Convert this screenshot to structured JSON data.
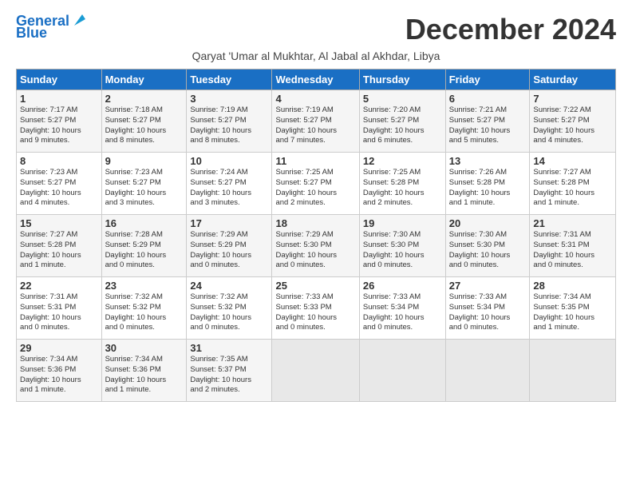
{
  "logo": {
    "line1": "General",
    "line2": "Blue"
  },
  "title": "December 2024",
  "subtitle": "Qaryat 'Umar al Mukhtar, Al Jabal al Akhdar, Libya",
  "headers": [
    "Sunday",
    "Monday",
    "Tuesday",
    "Wednesday",
    "Thursday",
    "Friday",
    "Saturday"
  ],
  "weeks": [
    [
      {
        "day": "1",
        "info": "Sunrise: 7:17 AM\nSunset: 5:27 PM\nDaylight: 10 hours\nand 9 minutes."
      },
      {
        "day": "2",
        "info": "Sunrise: 7:18 AM\nSunset: 5:27 PM\nDaylight: 10 hours\nand 8 minutes."
      },
      {
        "day": "3",
        "info": "Sunrise: 7:19 AM\nSunset: 5:27 PM\nDaylight: 10 hours\nand 8 minutes."
      },
      {
        "day": "4",
        "info": "Sunrise: 7:19 AM\nSunset: 5:27 PM\nDaylight: 10 hours\nand 7 minutes."
      },
      {
        "day": "5",
        "info": "Sunrise: 7:20 AM\nSunset: 5:27 PM\nDaylight: 10 hours\nand 6 minutes."
      },
      {
        "day": "6",
        "info": "Sunrise: 7:21 AM\nSunset: 5:27 PM\nDaylight: 10 hours\nand 5 minutes."
      },
      {
        "day": "7",
        "info": "Sunrise: 7:22 AM\nSunset: 5:27 PM\nDaylight: 10 hours\nand 4 minutes."
      }
    ],
    [
      {
        "day": "8",
        "info": "Sunrise: 7:23 AM\nSunset: 5:27 PM\nDaylight: 10 hours\nand 4 minutes."
      },
      {
        "day": "9",
        "info": "Sunrise: 7:23 AM\nSunset: 5:27 PM\nDaylight: 10 hours\nand 3 minutes."
      },
      {
        "day": "10",
        "info": "Sunrise: 7:24 AM\nSunset: 5:27 PM\nDaylight: 10 hours\nand 3 minutes."
      },
      {
        "day": "11",
        "info": "Sunrise: 7:25 AM\nSunset: 5:27 PM\nDaylight: 10 hours\nand 2 minutes."
      },
      {
        "day": "12",
        "info": "Sunrise: 7:25 AM\nSunset: 5:28 PM\nDaylight: 10 hours\nand 2 minutes."
      },
      {
        "day": "13",
        "info": "Sunrise: 7:26 AM\nSunset: 5:28 PM\nDaylight: 10 hours\nand 1 minute."
      },
      {
        "day": "14",
        "info": "Sunrise: 7:27 AM\nSunset: 5:28 PM\nDaylight: 10 hours\nand 1 minute."
      }
    ],
    [
      {
        "day": "15",
        "info": "Sunrise: 7:27 AM\nSunset: 5:28 PM\nDaylight: 10 hours\nand 1 minute."
      },
      {
        "day": "16",
        "info": "Sunrise: 7:28 AM\nSunset: 5:29 PM\nDaylight: 10 hours\nand 0 minutes."
      },
      {
        "day": "17",
        "info": "Sunrise: 7:29 AM\nSunset: 5:29 PM\nDaylight: 10 hours\nand 0 minutes."
      },
      {
        "day": "18",
        "info": "Sunrise: 7:29 AM\nSunset: 5:30 PM\nDaylight: 10 hours\nand 0 minutes."
      },
      {
        "day": "19",
        "info": "Sunrise: 7:30 AM\nSunset: 5:30 PM\nDaylight: 10 hours\nand 0 minutes."
      },
      {
        "day": "20",
        "info": "Sunrise: 7:30 AM\nSunset: 5:30 PM\nDaylight: 10 hours\nand 0 minutes."
      },
      {
        "day": "21",
        "info": "Sunrise: 7:31 AM\nSunset: 5:31 PM\nDaylight: 10 hours\nand 0 minutes."
      }
    ],
    [
      {
        "day": "22",
        "info": "Sunrise: 7:31 AM\nSunset: 5:31 PM\nDaylight: 10 hours\nand 0 minutes."
      },
      {
        "day": "23",
        "info": "Sunrise: 7:32 AM\nSunset: 5:32 PM\nDaylight: 10 hours\nand 0 minutes."
      },
      {
        "day": "24",
        "info": "Sunrise: 7:32 AM\nSunset: 5:32 PM\nDaylight: 10 hours\nand 0 minutes."
      },
      {
        "day": "25",
        "info": "Sunrise: 7:33 AM\nSunset: 5:33 PM\nDaylight: 10 hours\nand 0 minutes."
      },
      {
        "day": "26",
        "info": "Sunrise: 7:33 AM\nSunset: 5:34 PM\nDaylight: 10 hours\nand 0 minutes."
      },
      {
        "day": "27",
        "info": "Sunrise: 7:33 AM\nSunset: 5:34 PM\nDaylight: 10 hours\nand 0 minutes."
      },
      {
        "day": "28",
        "info": "Sunrise: 7:34 AM\nSunset: 5:35 PM\nDaylight: 10 hours\nand 1 minute."
      }
    ],
    [
      {
        "day": "29",
        "info": "Sunrise: 7:34 AM\nSunset: 5:36 PM\nDaylight: 10 hours\nand 1 minute."
      },
      {
        "day": "30",
        "info": "Sunrise: 7:34 AM\nSunset: 5:36 PM\nDaylight: 10 hours\nand 1 minute."
      },
      {
        "day": "31",
        "info": "Sunrise: 7:35 AM\nSunset: 5:37 PM\nDaylight: 10 hours\nand 2 minutes."
      },
      {
        "day": "",
        "info": ""
      },
      {
        "day": "",
        "info": ""
      },
      {
        "day": "",
        "info": ""
      },
      {
        "day": "",
        "info": ""
      }
    ]
  ]
}
